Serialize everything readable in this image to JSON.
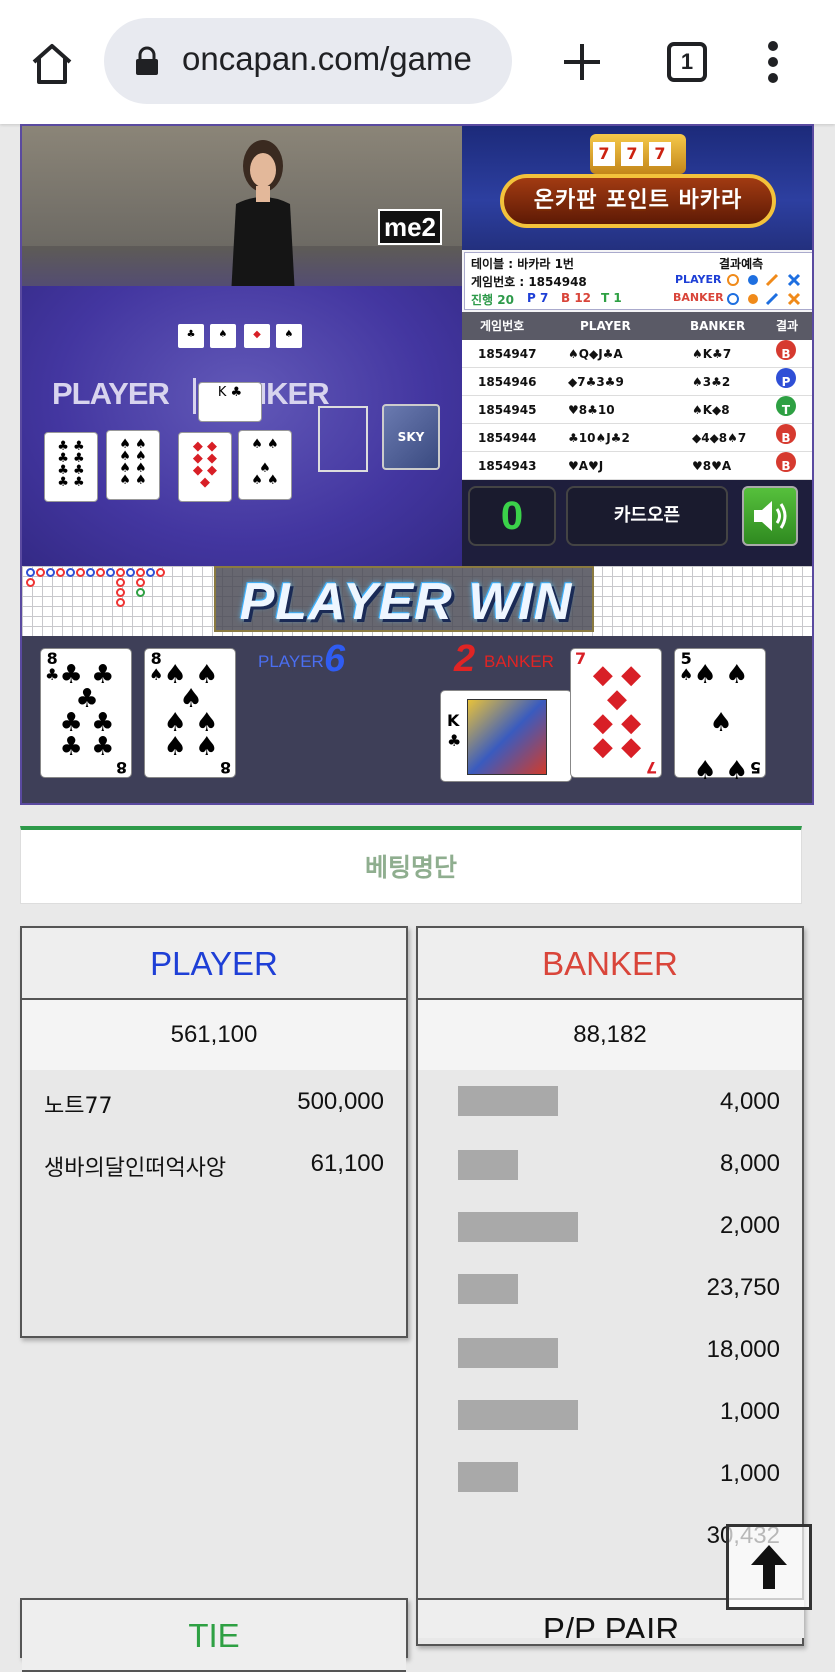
{
  "browser": {
    "url": "oncapan.com/game",
    "tab_count": "1"
  },
  "game": {
    "camera_logo": "me2",
    "felt_player": "PLAYER",
    "felt_banker": "BANKER",
    "shoe_label": "SKY",
    "banner_title": "온카판 포인트 바카라",
    "slot_digits": [
      "7",
      "7",
      "7"
    ],
    "table_label": "테이블 : 바카라 1번",
    "game_number_label": "게임번호 : 1854948",
    "progress": {
      "label": "진행 20",
      "p": "P 7",
      "b": "B 12",
      "t": "T 1"
    },
    "prediction_title": "결과예측",
    "prediction_player": "PLAYER",
    "prediction_banker": "BANKER",
    "history_headers": [
      "게임번호",
      "PLAYER",
      "BANKER",
      "결과"
    ],
    "history": [
      {
        "id": "1854947",
        "player": "♠Q◆J♣A",
        "banker": "♠K♣7",
        "result": "B",
        "color": "#d63a2f"
      },
      {
        "id": "1854946",
        "player": "◆7♣3♣9",
        "banker": "♠3♣2",
        "result": "P",
        "color": "#2f4fd6"
      },
      {
        "id": "1854945",
        "player": "♥8♣10",
        "banker": "♠K◆8",
        "result": "T",
        "color": "#2ea043"
      },
      {
        "id": "1854944",
        "player": "♣10♠J♣2",
        "banker": "◆4◆8♠7",
        "result": "B",
        "color": "#d63a2f"
      },
      {
        "id": "1854943",
        "player": "♥A♥J",
        "banker": "♥8♥A",
        "result": "B",
        "color": "#d63a2f"
      }
    ],
    "countdown": "0",
    "card_open_label": "카드오픈",
    "win_text": "PLAYER WIN",
    "player_label": "PLAYER",
    "player_score": "6",
    "banker_label": "BANKER",
    "banker_score": "2",
    "player_cards": [
      {
        "rank": "8",
        "suit": "♣",
        "color": "#111"
      },
      {
        "rank": "8",
        "suit": "♠",
        "color": "#111"
      }
    ],
    "banker_cards": [
      {
        "rank": "K",
        "suit": "♣",
        "color": "#111"
      },
      {
        "rank": "7",
        "suit": "◆",
        "color": "#d81f26"
      },
      {
        "rank": "5",
        "suit": "♠",
        "color": "#111"
      }
    ]
  },
  "betting": {
    "title": "베팅명단",
    "player": {
      "label": "PLAYER",
      "color": "#1e3fd6",
      "total": "561,100",
      "bets": [
        {
          "name": "노트77",
          "amount": "500,000"
        },
        {
          "name": "생바의달인떠억사앙",
          "amount": "61,100"
        }
      ]
    },
    "banker": {
      "label": "BANKER",
      "color": "#d9453a",
      "total": "88,182",
      "amounts": [
        "4,000",
        "8,000",
        "2,000",
        "23,750",
        "18,000",
        "1,000",
        "1,000",
        "30,432"
      ]
    },
    "tie_label": "TIE",
    "pp_label": "P/P PAIR"
  },
  "colors": {
    "player_blue": "#1e3fd6",
    "banker_red": "#d9453a",
    "tie_green": "#2ea043",
    "accent_green": "#2e9a4a"
  }
}
